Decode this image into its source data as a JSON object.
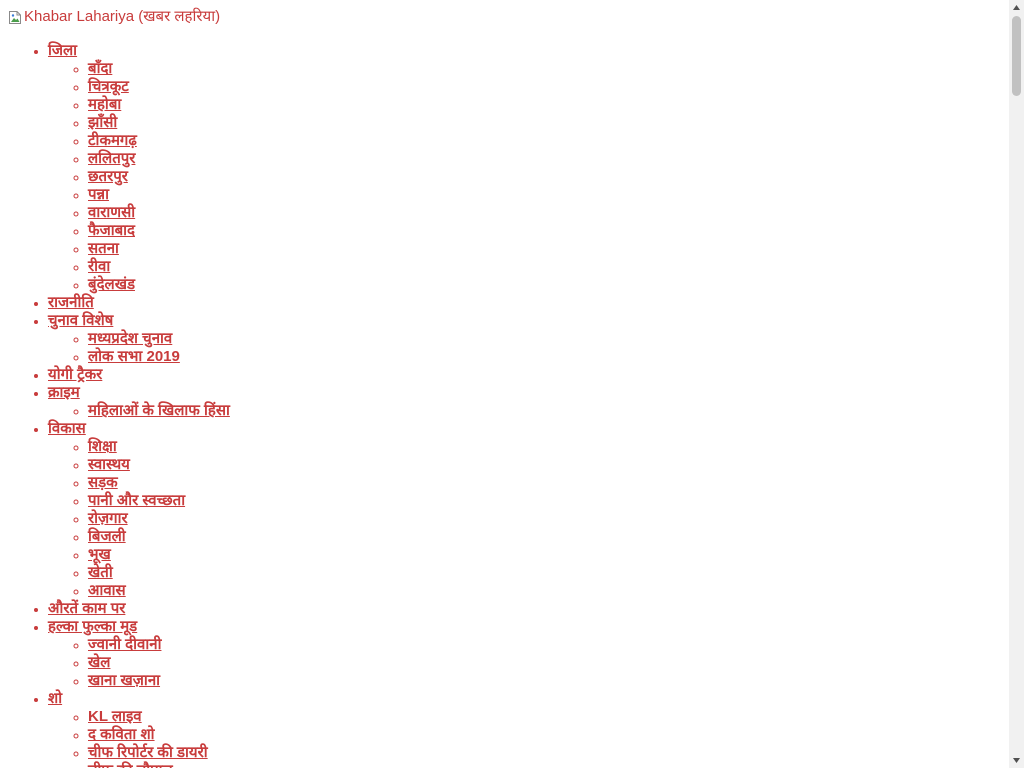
{
  "header": {
    "logo_alt": "Khabar Lahariya (खबर लहरिया)"
  },
  "colors": {
    "link": "#c83c3c",
    "scrollbar_track": "#f1f1f1",
    "scrollbar_thumb": "#c1c1c1"
  },
  "menu": [
    {
      "label": "जिला",
      "children": [
        "बाँदा",
        "चित्रकूट",
        "महोबा",
        "झाँसी",
        "टीकमगढ़",
        "ललितपुर",
        "छतरपुर",
        "पन्ना",
        "वाराणसी",
        "फैजाबाद",
        "सतना",
        "रीवा",
        "बुंदेलखंड"
      ]
    },
    {
      "label": "राजनीति",
      "children": []
    },
    {
      "label": "चुनाव विशेष",
      "children": [
        "मध्यप्रदेश चुनाव",
        "लोक सभा 2019"
      ]
    },
    {
      "label": "योगी ट्रैकर",
      "children": []
    },
    {
      "label": "क्राइम",
      "children": [
        "महिलाओं के खिलाफ हिंसा"
      ]
    },
    {
      "label": "विकास",
      "children": [
        "शिक्षा",
        "स्वास्थय",
        "सड़क",
        "पानी और स्वच्छता",
        "रोज़गार",
        "बिजली",
        "भूख",
        "खेती",
        "आवास"
      ]
    },
    {
      "label": "औरतें काम पर",
      "children": []
    },
    {
      "label": "हल्का फुल्का मूड",
      "children": [
        "ज्वानी दीवानी",
        "खेल",
        "खाना खज़ाना"
      ]
    },
    {
      "label": "शो",
      "children": [
        "KL लाइव",
        "द कविता शो",
        "चीफ रिपोर्टर की डायरी",
        "चीफ की चौपाल"
      ]
    }
  ],
  "icons": {
    "broken_image": "broken-image-icon",
    "scroll_up": "arrow-up-icon",
    "scroll_down": "arrow-down-icon"
  }
}
